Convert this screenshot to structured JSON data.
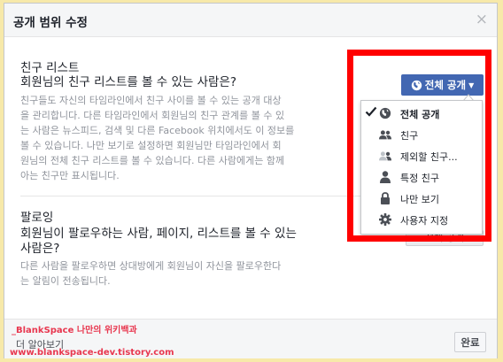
{
  "dialog": {
    "title": "공개 범위 수정",
    "close_glyph": "×"
  },
  "sections": [
    {
      "title": "친구 리스트",
      "question": "회원님의 친구 리스트를 볼 수 있는 사람은?",
      "description_lines": [
        "친구들도 자신의 타임라인에서 친구 사이를 볼 수 있는 공개 대상",
        "을 관리합니다. 다른 타임라인에서 회원님의 친구 관계를 볼 수 있",
        "는 사람은 뉴스피드, 검색 및 다른 Facebook 위치에서도 이 정보를",
        "볼 수 있습니다. 나만 보기로 설정하면 회원님만 타임라인에서 회",
        "원님의 전체 친구 리스트를 볼 수 있습니다. 다른 사람에게는 함께",
        "아는 친구만 표시됩니다."
      ]
    },
    {
      "title": "팔로잉",
      "question_lines": [
        "회원님이 팔로우하는 사람, 페이지, 리스트를 볼 수 있는",
        "사람은?"
      ],
      "description_lines": [
        "다른 사람을 팔로우하면 상대방에게 회원님이 자신을 팔로우한다",
        "는 알림이 전송됩니다."
      ]
    }
  ],
  "privacy_button": {
    "label": "전체 공개",
    "icon": "globe-icon"
  },
  "behind_button_label": "전체 공개",
  "menu": {
    "items": [
      {
        "label": "전체 공개",
        "icon": "globe-icon",
        "checked": true
      },
      {
        "label": "친구",
        "icon": "friends-icon",
        "checked": false
      },
      {
        "label": "제외할 친구...",
        "icon": "friends-except-icon",
        "checked": false
      },
      {
        "label": "특정 친구",
        "icon": "person-icon",
        "checked": false
      },
      {
        "label": "나만 보기",
        "icon": "lock-icon",
        "checked": false
      },
      {
        "label": "사용자 지정",
        "icon": "gear-icon",
        "checked": false
      }
    ]
  },
  "footer": {
    "brand": "_BlankSpace 나만의 위키백과",
    "learn_more": "더 알아보기",
    "url": "www.blankspace-dev.tistory.com",
    "done_label": "완료"
  },
  "colors": {
    "page_bg": "#f7e9a9",
    "accent": "#4267b2",
    "highlight_frame": "#ff0000",
    "watermark": "#e8374f"
  }
}
